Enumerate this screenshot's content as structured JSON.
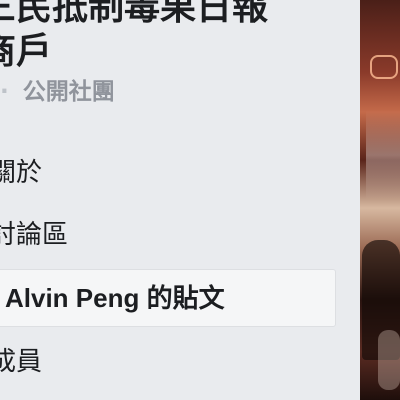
{
  "group": {
    "title_line1": "三民抵制毒果日報",
    "title_line2": "商戶",
    "privacy_dot": "·",
    "privacy_label": "公開社團"
  },
  "nav": {
    "about": "關於",
    "discussion": "討論區",
    "posts": "Alvin Peng 的貼文",
    "members": "成員"
  },
  "colors": {
    "background": "#e9ebee",
    "selected_item_bg": "#f5f6f7",
    "text_primary": "#1c1e21",
    "text_secondary": "#90949c"
  }
}
